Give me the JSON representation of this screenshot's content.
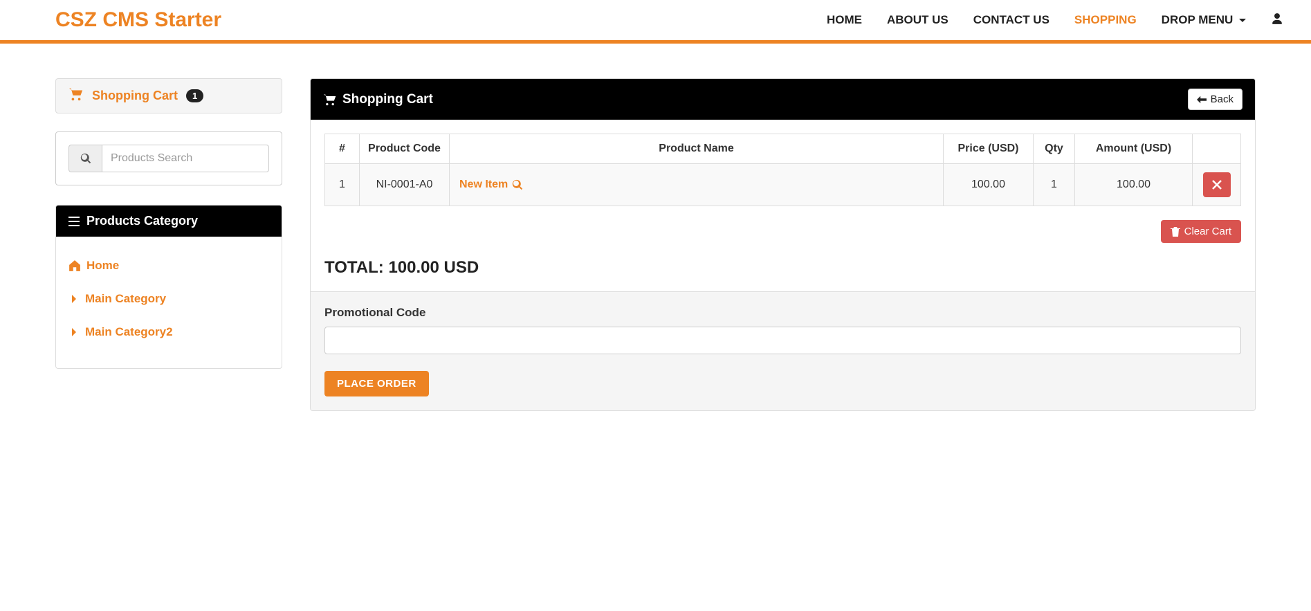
{
  "brand": "CSZ CMS Starter",
  "nav": {
    "items": [
      "HOME",
      "ABOUT US",
      "CONTACT US",
      "SHOPPING",
      "DROP MENU"
    ],
    "active": 3
  },
  "sidebar": {
    "cart_widget_label": "Shopping Cart",
    "cart_count": "1",
    "search_placeholder": "Products Search",
    "category_header": "Products Category",
    "categories": [
      {
        "label": "Home",
        "icon": "home"
      },
      {
        "label": "Main Category",
        "icon": "caret"
      },
      {
        "label": "Main Category2",
        "icon": "caret"
      }
    ]
  },
  "cart": {
    "title": "Shopping Cart",
    "back_label": "Back",
    "columns": {
      "num": "#",
      "code": "Product Code",
      "name": "Product Name",
      "price": "Price (USD)",
      "qty": "Qty",
      "amount": "Amount (USD)"
    },
    "rows": [
      {
        "num": "1",
        "code": "NI-0001-A0",
        "name": "New Item",
        "price": "100.00",
        "qty": "1",
        "amount": "100.00"
      }
    ],
    "clear_label": "Clear Cart",
    "total_label": "TOTAL:",
    "total_value": "100.00 USD",
    "promo_label": "Promotional Code",
    "place_order_label": "PLACE ORDER"
  }
}
